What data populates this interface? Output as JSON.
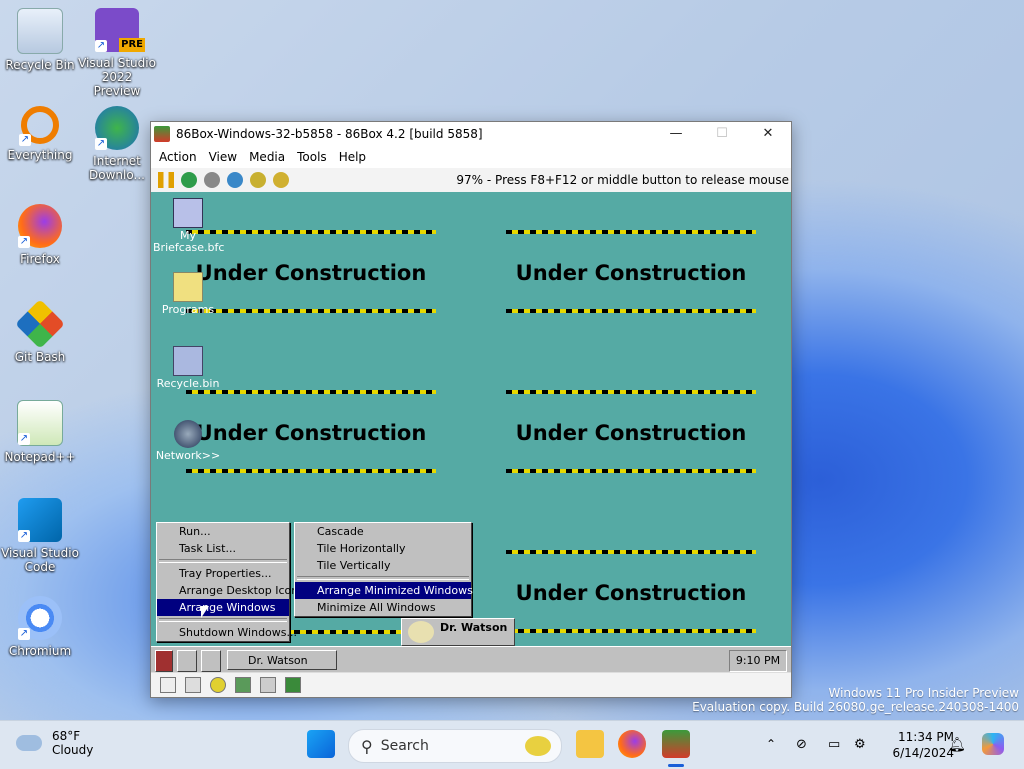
{
  "desktop": {
    "icons": [
      {
        "label": "Recycle Bin"
      },
      {
        "label": "Visual Studio 2022 Preview",
        "badge": "PRE"
      },
      {
        "label": "Everything"
      },
      {
        "label": "Internet Downlo..."
      },
      {
        "label": "Firefox"
      },
      {
        "label": "Git Bash"
      },
      {
        "label": "Notepad++"
      },
      {
        "label": "Visual Studio Code"
      },
      {
        "label": "Chromium"
      }
    ]
  },
  "window": {
    "title": "86Box-Windows-32-b5858 - 86Box 4.2 [build 5858]",
    "menus": [
      "Action",
      "View",
      "Media",
      "Tools",
      "Help"
    ],
    "status_text": "97% - Press F8+F12 or middle button to release mouse"
  },
  "guest": {
    "icons": [
      {
        "label": "My Briefcase.bfc"
      },
      {
        "label": "Programs"
      },
      {
        "label": "Recycle.bin"
      },
      {
        "label": "Network>>"
      }
    ],
    "under_construction": "Under Construction",
    "start_menu": [
      {
        "label": "Run..."
      },
      {
        "label": "Task List..."
      },
      {
        "label": "Tray Properties..."
      },
      {
        "label": "Arrange Desktop Icons"
      },
      {
        "label": "Arrange Windows"
      },
      {
        "label": "Shutdown Windows..."
      }
    ],
    "submenu": [
      {
        "label": "Cascade"
      },
      {
        "label": "Tile Horizontally"
      },
      {
        "label": "Tile Vertically"
      },
      {
        "label": "Arrange Minimized Windows"
      },
      {
        "label": "Minimize All Windows"
      }
    ],
    "dr_watson_icon_label": "Dr. Watson",
    "taskbar_button": "Dr. Watson",
    "clock": "9:10 PM"
  },
  "watermark": {
    "line1": "Windows 11 Pro Insider Preview",
    "line2": "Evaluation copy. Build 26080.ge_release.240308-1400"
  },
  "taskbar": {
    "weather_temp": "68°F",
    "weather_desc": "Cloudy",
    "search_placeholder": "Search",
    "time": "11:34 PM",
    "date": "6/14/2024"
  },
  "colors": {
    "guest_desktop": "#55aaa4",
    "menu_highlight": "#000080",
    "stripe_yellow": "#e6d800"
  }
}
